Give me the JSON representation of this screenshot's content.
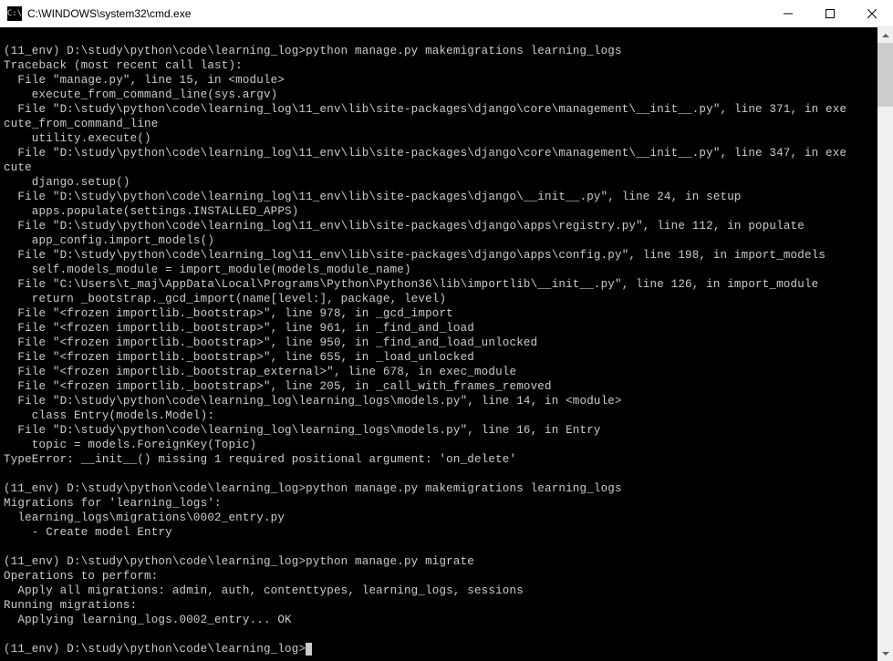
{
  "window": {
    "title": "C:\\WINDOWS\\system32\\cmd.exe",
    "icon_label": "C:\\"
  },
  "terminal": {
    "lines": [
      "",
      "(11_env) D:\\study\\python\\code\\learning_log>python manage.py makemigrations learning_logs",
      "Traceback (most recent call last):",
      "  File \"manage.py\", line 15, in <module>",
      "    execute_from_command_line(sys.argv)",
      "  File \"D:\\study\\python\\code\\learning_log\\11_env\\lib\\site-packages\\django\\core\\management\\__init__.py\", line 371, in exe",
      "cute_from_command_line",
      "    utility.execute()",
      "  File \"D:\\study\\python\\code\\learning_log\\11_env\\lib\\site-packages\\django\\core\\management\\__init__.py\", line 347, in exe",
      "cute",
      "    django.setup()",
      "  File \"D:\\study\\python\\code\\learning_log\\11_env\\lib\\site-packages\\django\\__init__.py\", line 24, in setup",
      "    apps.populate(settings.INSTALLED_APPS)",
      "  File \"D:\\study\\python\\code\\learning_log\\11_env\\lib\\site-packages\\django\\apps\\registry.py\", line 112, in populate",
      "    app_config.import_models()",
      "  File \"D:\\study\\python\\code\\learning_log\\11_env\\lib\\site-packages\\django\\apps\\config.py\", line 198, in import_models",
      "    self.models_module = import_module(models_module_name)",
      "  File \"C:\\Users\\t_maj\\AppData\\Local\\Programs\\Python\\Python36\\lib\\importlib\\__init__.py\", line 126, in import_module",
      "    return _bootstrap._gcd_import(name[level:], package, level)",
      "  File \"<frozen importlib._bootstrap>\", line 978, in _gcd_import",
      "  File \"<frozen importlib._bootstrap>\", line 961, in _find_and_load",
      "  File \"<frozen importlib._bootstrap>\", line 950, in _find_and_load_unlocked",
      "  File \"<frozen importlib._bootstrap>\", line 655, in _load_unlocked",
      "  File \"<frozen importlib._bootstrap_external>\", line 678, in exec_module",
      "  File \"<frozen importlib._bootstrap>\", line 205, in _call_with_frames_removed",
      "  File \"D:\\study\\python\\code\\learning_log\\learning_logs\\models.py\", line 14, in <module>",
      "    class Entry(models.Model):",
      "  File \"D:\\study\\python\\code\\learning_log\\learning_logs\\models.py\", line 16, in Entry",
      "    topic = models.ForeignKey(Topic)",
      "TypeError: __init__() missing 1 required positional argument: 'on_delete'",
      "",
      "(11_env) D:\\study\\python\\code\\learning_log>python manage.py makemigrations learning_logs",
      "Migrations for 'learning_logs':",
      "  learning_logs\\migrations\\0002_entry.py",
      "    - Create model Entry",
      "",
      "(11_env) D:\\study\\python\\code\\learning_log>python manage.py migrate",
      "Operations to perform:",
      "  Apply all migrations: admin, auth, contenttypes, learning_logs, sessions",
      "Running migrations:",
      "  Applying learning_logs.0002_entry... OK",
      "",
      "(11_env) D:\\study\\python\\code\\learning_log>"
    ]
  }
}
